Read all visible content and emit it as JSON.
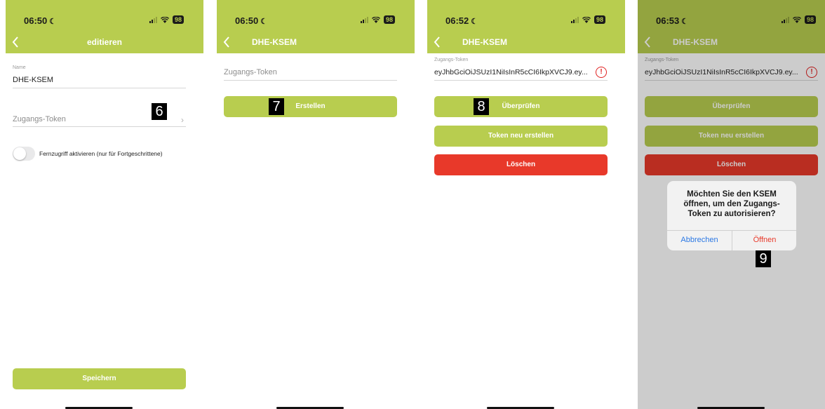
{
  "colors": {
    "accent": "#b8cd4f",
    "danger": "#e8392a",
    "link": "#2b78e4"
  },
  "icons": {
    "back": "chevron-left-icon",
    "moon": "moon-icon",
    "signal": "signal-icon",
    "wifi": "wifi-icon",
    "battery": "battery-icon",
    "chevron_right": "chevron-right-icon",
    "error": "exclamation-circle-icon"
  },
  "screens": [
    {
      "time": "06:50",
      "battery": "98",
      "title": "editieren",
      "name_label": "Name",
      "name_value": "DHE-KSEM",
      "token_placeholder": "Zugangs-Token",
      "toggle_label": "Fernzugriff aktivieren (nur für Fortgeschrittene)",
      "save_button": "Speichern",
      "step": "6"
    },
    {
      "time": "06:50",
      "battery": "98",
      "title": "DHE-KSEM",
      "token_placeholder": "Zugangs-Token",
      "create_button": "Erstellen",
      "step": "7"
    },
    {
      "time": "06:52",
      "battery": "98",
      "title": "DHE-KSEM",
      "token_label": "Zugangs-Token",
      "token_value": "eyJhbGciOiJSUzI1NiIsInR5cCI6IkpXVCJ9.ey...",
      "verify_button": "Überprüfen",
      "regenerate_button": "Token neu erstellen",
      "delete_button": "Löschen",
      "step": "8"
    },
    {
      "time": "06:53",
      "battery": "98",
      "title": "DHE-KSEM",
      "token_label": "Zugangs-Token",
      "token_value": "eyJhbGciOiJSUzI1NiIsInR5cCI6IkpXVCJ9.ey...",
      "verify_button": "Überprüfen",
      "regenerate_button": "Token neu erstellen",
      "delete_button": "Löschen",
      "dialog": {
        "message": "Möchten Sie den KSEM öffnen, um den Zugangs-Token zu autorisieren?",
        "cancel": "Abbrechen",
        "open": "Öffnen"
      },
      "step": "9"
    }
  ]
}
